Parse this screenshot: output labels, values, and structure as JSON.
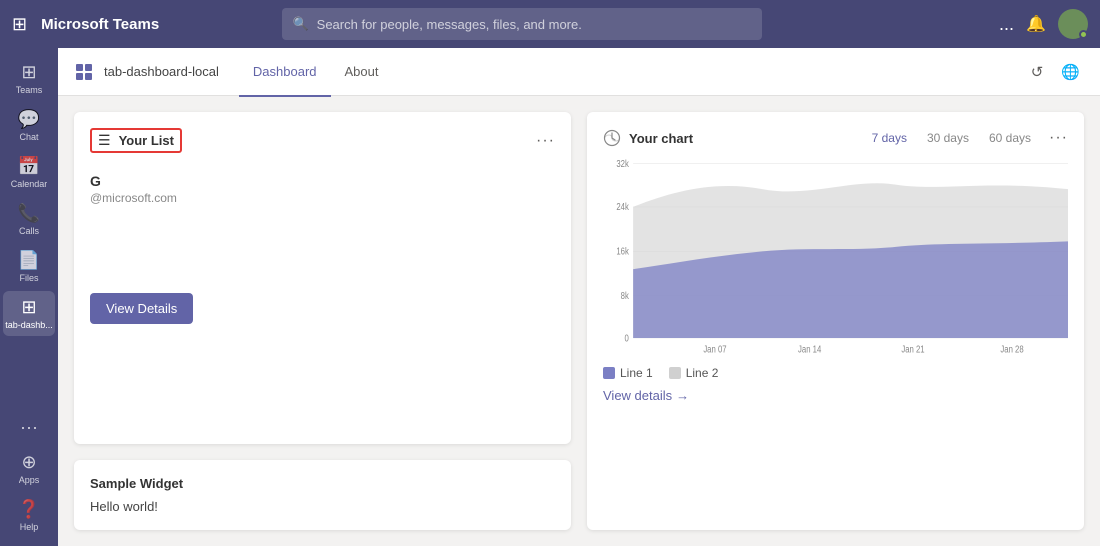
{
  "topbar": {
    "dots_label": "⋮⋮⋮",
    "title": "Microsoft Teams",
    "search_placeholder": "Search for people, messages, files, and more.",
    "more_label": "...",
    "bell_icon": "🔔",
    "avatar_initials": ""
  },
  "sidebar": {
    "items": [
      {
        "id": "teams",
        "label": "Teams",
        "icon": "⊞"
      },
      {
        "id": "chat",
        "label": "Chat",
        "icon": "💬"
      },
      {
        "id": "calendar",
        "label": "Calendar",
        "icon": "📅"
      },
      {
        "id": "calls",
        "label": "Calls",
        "icon": "📞"
      },
      {
        "id": "files",
        "label": "Files",
        "icon": "📄"
      },
      {
        "id": "tab-dashboard",
        "label": "tab-dashb...",
        "icon": "⊞",
        "active": true
      }
    ],
    "more_label": "..."
  },
  "tabbar": {
    "app_icon": "⊟",
    "app_name": "tab-dashboard-local",
    "tabs": [
      {
        "id": "dashboard",
        "label": "Dashboard",
        "active": true
      },
      {
        "id": "about",
        "label": "About",
        "active": false
      }
    ],
    "refresh_icon": "↺",
    "globe_icon": "🌐"
  },
  "your_list_card": {
    "title": "Your List",
    "menu_label": "···",
    "list_item": {
      "name": "G",
      "sub": "@microsoft.com"
    },
    "view_details_label": "View Details"
  },
  "sample_widget": {
    "title": "Sample Widget",
    "body": "Hello world!"
  },
  "your_chart_card": {
    "title": "Your chart",
    "menu_label": "···",
    "period_tabs": [
      {
        "id": "7days",
        "label": "7 days",
        "active": true
      },
      {
        "id": "30days",
        "label": "30 days",
        "active": false
      },
      {
        "id": "60days",
        "label": "60 days",
        "active": false
      }
    ],
    "y_labels": [
      "32k",
      "24k",
      "16k",
      "8k",
      "0"
    ],
    "x_labels": [
      "Jan 07",
      "Jan 14",
      "Jan 21",
      "Jan 28"
    ],
    "legend": [
      {
        "id": "line1",
        "label": "Line 1"
      },
      {
        "id": "line2",
        "label": "Line 2"
      }
    ],
    "view_details_label": "View details",
    "view_details_arrow": "→"
  }
}
